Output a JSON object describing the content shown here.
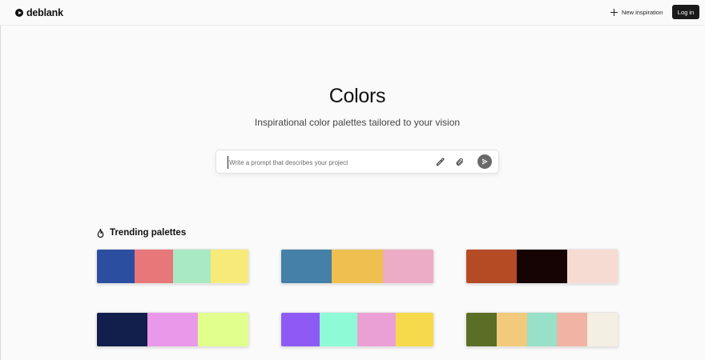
{
  "header": {
    "logo_text": "deblank",
    "new_inspiration_label": "New inspiration",
    "login_label": "Log in"
  },
  "hero": {
    "title": "Colors",
    "subtitle": "Inspirational color palettes tailored to your vision"
  },
  "prompt": {
    "placeholder": "Write a prompt that describes your project",
    "value": ""
  },
  "icons": {
    "dropper": "eyedropper-icon",
    "attach": "paperclip-icon",
    "send": "send-icon",
    "trending": "flame-icon",
    "new": "plus-icon"
  },
  "trending": {
    "label": "Trending palettes",
    "palettes": [
      {
        "colors": [
          "#2c4ea1",
          "#e77778",
          "#a9e9c4",
          "#f8ea78"
        ]
      },
      {
        "colors": [
          "#4480a8",
          "#efbf4f",
          "#edacc5"
        ]
      },
      {
        "colors": [
          "#b54b25",
          "#160304",
          "#f6dbd2"
        ]
      },
      {
        "colors": [
          "#121e4b",
          "#ea98ea",
          "#e1ff8d"
        ]
      },
      {
        "colors": [
          "#8d5bf4",
          "#8ffbd6",
          "#eaa0d4",
          "#f7da4c"
        ]
      },
      {
        "colors": [
          "#5a6e25",
          "#f1cb7b",
          "#98e0c8",
          "#f1b3a3",
          "#f5eee3"
        ]
      }
    ]
  }
}
